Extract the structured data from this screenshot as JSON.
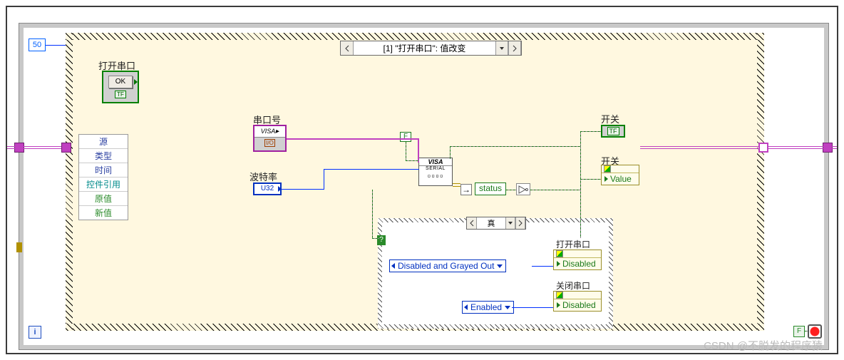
{
  "loop": {
    "wait_ms": "50",
    "iter_label": "i",
    "stop_f": "F"
  },
  "event_case": {
    "index": "[1]",
    "name": "\"打开串口\": 值改变"
  },
  "controls": {
    "open_serial": {
      "label": "打开串口",
      "button": "OK",
      "type": "TF"
    },
    "serial_port": {
      "label": "串口号",
      "type": "VISA",
      "io": "I/O"
    },
    "baud": {
      "label": "波特率",
      "type": "U32"
    },
    "switch": {
      "label": "开关",
      "type": "TF"
    }
  },
  "unbundle": {
    "items": [
      "源",
      "类型",
      "时间",
      "控件引用",
      "原值",
      "新值"
    ]
  },
  "visa_node": {
    "header": "VISA",
    "sub": "SERIAL",
    "pins": "▫▫▫▫"
  },
  "f_const": "F",
  "error": {
    "status_label": "status"
  },
  "switch_prop": {
    "label": "开关",
    "value_name": "Value"
  },
  "inner_case": {
    "selector": "真",
    "enum1": "Disabled and Grayed Out",
    "enum2": "Enabled",
    "prop1": {
      "label": "打开串口",
      "name": "Disabled"
    },
    "prop2": {
      "label": "关闭串口",
      "name": "Disabled"
    }
  },
  "watermark": "CSDN @不脱发的程序猿"
}
